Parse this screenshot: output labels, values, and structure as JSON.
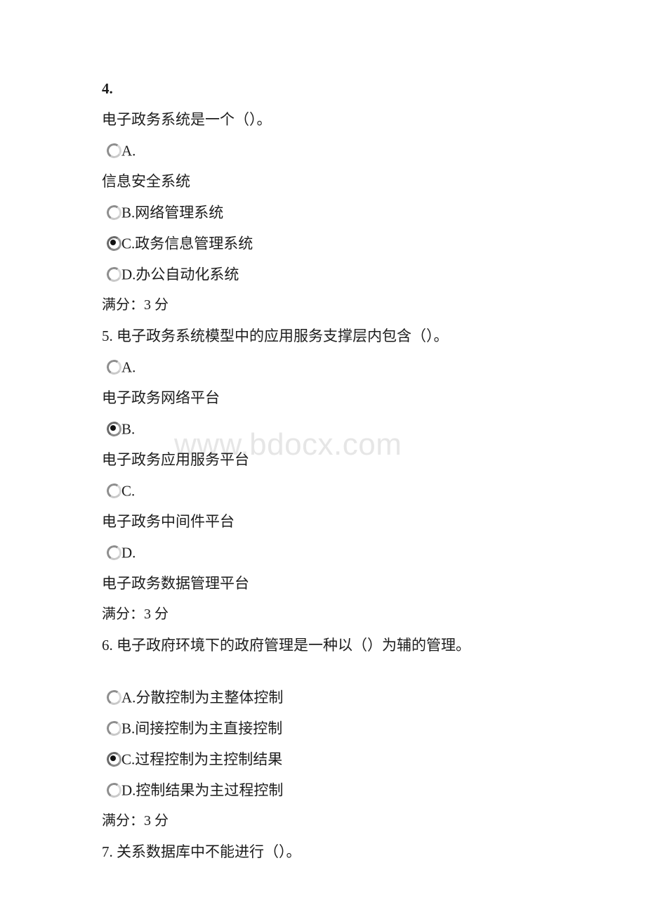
{
  "document": {
    "watermark": "www.bdocx.com",
    "score_line": "满分：3 分"
  },
  "questions": [
    {
      "number": "4.",
      "stem": "电子政务系统是一个（）。",
      "stem_on_own_line": true,
      "options": [
        {
          "label": "A.",
          "text": "",
          "body": "信息安全系统",
          "selected": false
        },
        {
          "label": "B.",
          "text": "网络管理系统",
          "body": "",
          "selected": false
        },
        {
          "label": "C.",
          "text": "政务信息管理系统",
          "body": "",
          "selected": true
        },
        {
          "label": "D.",
          "text": "办公自动化系统",
          "body": "",
          "selected": false
        }
      ],
      "score": "满分：3 分"
    },
    {
      "number": "5.",
      "stem": "电子政务系统模型中的应用服务支撑层内包含（）。",
      "stem_on_own_line": false,
      "options": [
        {
          "label": "A.",
          "text": "",
          "body": "电子政务网络平台",
          "selected": false
        },
        {
          "label": "B.",
          "text": "",
          "body": "电子政务应用服务平台",
          "selected": true
        },
        {
          "label": "C.",
          "text": "",
          "body": "电子政务中间件平台",
          "selected": false
        },
        {
          "label": "D.",
          "text": "",
          "body": "电子政务数据管理平台",
          "selected": false
        }
      ],
      "score": "满分：3 分"
    },
    {
      "number": "6.",
      "stem": "电子政府环境下的政府管理是一种以（）为辅的管理。",
      "stem_on_own_line": false,
      "gap_after_stem": true,
      "options": [
        {
          "label": "A.",
          "text": "分散控制为主整体控制",
          "body": "",
          "selected": false
        },
        {
          "label": "B.",
          "text": "间接控制为主直接控制",
          "body": "",
          "selected": false
        },
        {
          "label": "C.",
          "text": "过程控制为主控制结果",
          "body": "",
          "selected": true
        },
        {
          "label": "D.",
          "text": "控制结果为主过程控制",
          "body": "",
          "selected": false
        }
      ],
      "score": "满分：3 分"
    },
    {
      "number": "7.",
      "stem": "关系数据库中不能进行（）。",
      "stem_on_own_line": false,
      "options": [],
      "score": ""
    }
  ]
}
